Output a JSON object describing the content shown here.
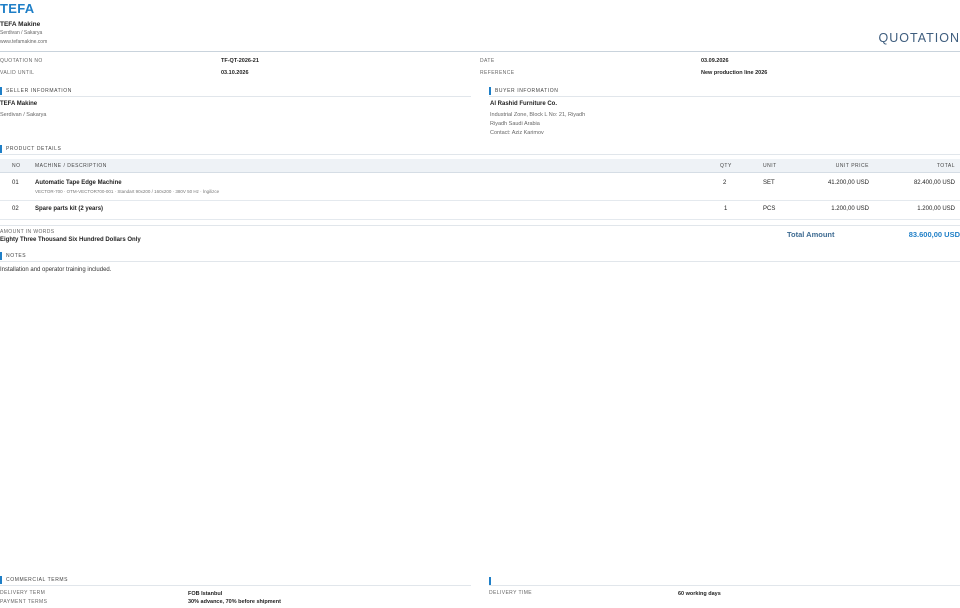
{
  "header": {
    "logo_text": "TEFA",
    "company_name": "TEFA Makine",
    "company_location": "Serdivan / Sakarya",
    "company_website": "www.tefamakine.com",
    "document_title": "QUOTATION"
  },
  "meta": {
    "quotation_no_label": "QUOTATION NO",
    "quotation_no": "TF-QT-2026-21",
    "valid_until_label": "VALID UNTIL",
    "valid_until": "03.10.2026",
    "date_label": "DATE",
    "date": "03.09.2026",
    "reference_label": "REFERENCE",
    "reference": "New production line 2026"
  },
  "seller": {
    "section_title": "SELLER INFORMATION",
    "name": "TEFA Makine",
    "location": "Serdivan / Sakarya"
  },
  "buyer": {
    "section_title": "BUYER INFORMATION",
    "name": "Al Rashid Furniture Co.",
    "address_line1": "Industrial Zone, Block L No: 21, Riyadh",
    "address_line2": "Riyadh Saudi Arabia",
    "contact": "Contact: Aziz Karimov"
  },
  "products": {
    "section_title": "PRODUCT DETAILS",
    "columns": {
      "no": "NO",
      "description": "MACHINE / DESCRIPTION",
      "qty": "QTY",
      "unit": "UNIT",
      "unit_price": "UNIT PRICE",
      "total": "TOTAL"
    },
    "items": [
      {
        "no": "01",
        "name": "Automatic Tape Edge Machine",
        "spec": "VECTOR-700 · OTM-VECTOR700-001 · Standart 90x200 / 160x200 · 380V 50 Hz · İngilizce",
        "qty": "2",
        "unit": "SET",
        "unit_price": "41.200,00 USD",
        "total": "82.400,00 USD"
      },
      {
        "no": "02",
        "name": "Spare parts kit (2 years)",
        "spec": "",
        "qty": "1",
        "unit": "PCS",
        "unit_price": "1.200,00 USD",
        "total": "1.200,00 USD"
      }
    ]
  },
  "totals": {
    "amount_in_words_label": "AMOUNT IN WORDS",
    "amount_in_words": "Eighty Three Thousand Six Hundred Dollars Only",
    "total_label": "Total Amount",
    "total_value": "83.600,00 USD"
  },
  "notes": {
    "section_title": "NOTES",
    "text": "Installation and operator training included."
  },
  "commercial_terms": {
    "section_title": "COMMERCIAL TERMS",
    "delivery_term_label": "DELIVERY TERM",
    "delivery_term": "FOB Istanbul",
    "payment_terms_label": "PAYMENT TERMS",
    "payment_terms": "30% advance, 70% before shipment",
    "delivery_time_label": "DELIVERY TIME",
    "delivery_time": "60 working days"
  },
  "colors": {
    "accent": "#1f7fc7",
    "title": "#3e5d7e"
  }
}
